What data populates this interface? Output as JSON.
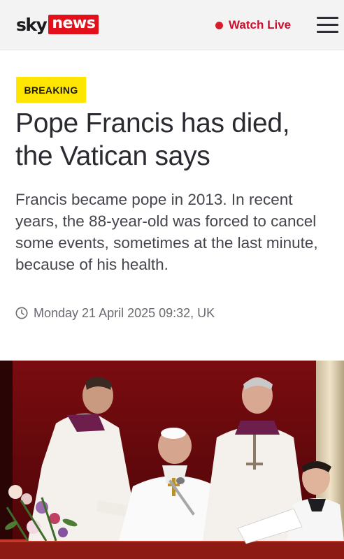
{
  "header": {
    "logo": {
      "sky": "sky",
      "news": "news"
    },
    "watch_live_label": "Watch Live",
    "menu_icon": "hamburger-menu-icon"
  },
  "article": {
    "badge": "BREAKING",
    "headline": "Pope Francis has died, the Vatican says",
    "standfirst": "Francis became pope in 2013. In recent years, the 88-year-old was forced to cancel some events, sometimes at the last minute, because of his health.",
    "timestamp": "Monday 21 April 2025 09:32, UK",
    "timestamp_icon": "clock-icon",
    "photo": "article-photo"
  },
  "colors": {
    "brand_red": "#e3101b",
    "live_red": "#c8102e",
    "breaking_yellow": "#ffe600",
    "header_bg": "#f3f3f4",
    "headline_text": "#2a2a31"
  }
}
